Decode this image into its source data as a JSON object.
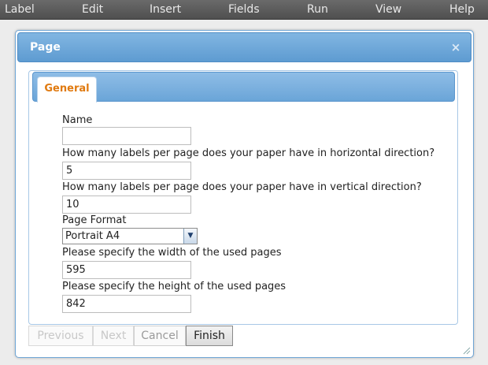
{
  "menubar": {
    "items": [
      {
        "label": "Label"
      },
      {
        "label": "Edit"
      },
      {
        "label": "Insert"
      },
      {
        "label": "Fields"
      },
      {
        "label": "Run"
      },
      {
        "label": "View"
      },
      {
        "label": "Help"
      }
    ]
  },
  "dialog": {
    "title": "Page",
    "close_glyph": "×",
    "close_icon": "close-icon",
    "resize_icon": "resize-grip-icon",
    "tabs": [
      {
        "label": "General",
        "active": true
      }
    ],
    "fields": {
      "name": {
        "label": "Name",
        "value": ""
      },
      "horizontal": {
        "label": "How many labels per page does your paper have in horizontal direction?",
        "value": "5"
      },
      "vertical": {
        "label": "How many labels per page does your paper have in vertical direction?",
        "value": "10"
      },
      "format": {
        "label": "Page Format",
        "value": "Portrait A4",
        "arrow_icon": "chevron-down-icon"
      },
      "width": {
        "label": "Please specify the width of the used pages",
        "value": "595"
      },
      "height": {
        "label": "Please specify the height of the used pages",
        "value": "842"
      }
    },
    "buttons": {
      "previous": {
        "label": "Previous",
        "enabled": false
      },
      "next": {
        "label": "Next",
        "enabled": false
      },
      "cancel": {
        "label": "Cancel",
        "enabled": true
      },
      "finish": {
        "label": "Finish",
        "enabled": true
      }
    }
  },
  "colors": {
    "menubar": "#5a5a5a",
    "dialog_title": "#6ba5d9",
    "tab_active_text": "#e07a10"
  }
}
